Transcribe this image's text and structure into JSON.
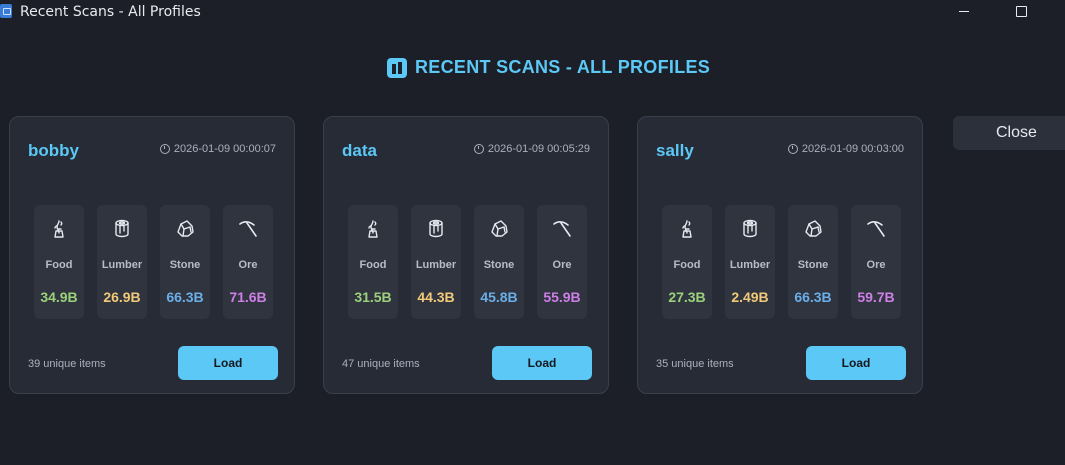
{
  "window": {
    "title": "Recent Scans - All Profiles"
  },
  "header": {
    "title": "RECENT SCANS - ALL PROFILES",
    "icon": "chart-bar-icon"
  },
  "colors": {
    "accent": "#5bc8f5",
    "food": "#9bd17a",
    "lumber": "#f2c978",
    "stone": "#6aaee8",
    "ore": "#cd7fe6"
  },
  "close_label": "Close",
  "cards": [
    {
      "name": "bobby",
      "timestamp": "2026-01-09 00:00:07",
      "resources": [
        {
          "label": "Food",
          "value": "34.9B",
          "icon": "food-icon"
        },
        {
          "label": "Lumber",
          "value": "26.9B",
          "icon": "lumber-icon"
        },
        {
          "label": "Stone",
          "value": "66.3B",
          "icon": "stone-icon"
        },
        {
          "label": "Ore",
          "value": "71.6B",
          "icon": "pickaxe-icon"
        }
      ],
      "items": "39 unique items",
      "load_label": "Load"
    },
    {
      "name": "data",
      "timestamp": "2026-01-09 00:05:29",
      "resources": [
        {
          "label": "Food",
          "value": "31.5B",
          "icon": "food-icon"
        },
        {
          "label": "Lumber",
          "value": "44.3B",
          "icon": "lumber-icon"
        },
        {
          "label": "Stone",
          "value": "45.8B",
          "icon": "stone-icon"
        },
        {
          "label": "Ore",
          "value": "55.9B",
          "icon": "pickaxe-icon"
        }
      ],
      "items": "47 unique items",
      "load_label": "Load"
    },
    {
      "name": "sally",
      "timestamp": "2026-01-09 00:03:00",
      "resources": [
        {
          "label": "Food",
          "value": "27.3B",
          "icon": "food-icon"
        },
        {
          "label": "Lumber",
          "value": "2.49B",
          "icon": "lumber-icon"
        },
        {
          "label": "Stone",
          "value": "66.3B",
          "icon": "stone-icon"
        },
        {
          "label": "Ore",
          "value": "59.7B",
          "icon": "pickaxe-icon"
        }
      ],
      "items": "35 unique items",
      "load_label": "Load"
    }
  ]
}
